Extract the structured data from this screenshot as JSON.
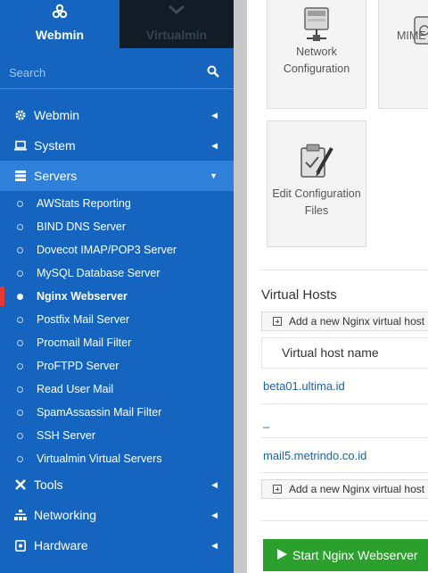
{
  "top_switch": {
    "webmin_label": "Webmin",
    "virtualmin_label": "Virtualmin"
  },
  "search": {
    "placeholder": "Search"
  },
  "menu": {
    "webmin": "Webmin",
    "system": "System",
    "servers": "Servers",
    "tools": "Tools",
    "networking": "Networking",
    "hardware": "Hardware"
  },
  "servers_items": [
    "AWStats Reporting",
    "BIND DNS Server",
    "Dovecot IMAP/POP3 Server",
    "MySQL Database Server",
    "Nginx Webserver",
    "Postfix Mail Server",
    "Procmail Mail Filter",
    "ProFTPD Server",
    "Read User Mail",
    "SpamAssassin Mail Filter",
    "SSH Server",
    "Virtualmin Virtual Servers"
  ],
  "current_item": "Nginx Webserver",
  "main": {
    "tile_network": [
      "Network",
      "Configuration"
    ],
    "tile_mime": "MIME",
    "tile_edit": [
      "Edit Configuration",
      "Files"
    ],
    "virtual_hosts_title": "Virtual Hosts",
    "add_host_label": "Add a new Nginx virtual host",
    "column_header": "Virtual host name",
    "hosts": [
      "beta01.ultima.id",
      "_",
      "mail5.metrindo.co.id"
    ],
    "start_button": "Start Nginx Webserver"
  },
  "colors": {
    "sidebar": "#1565c0",
    "active_menu": "#2f80d8",
    "virtualmin_tab": "#111c26",
    "start_button": "#2ca02c",
    "current_marker": "#e53935"
  }
}
